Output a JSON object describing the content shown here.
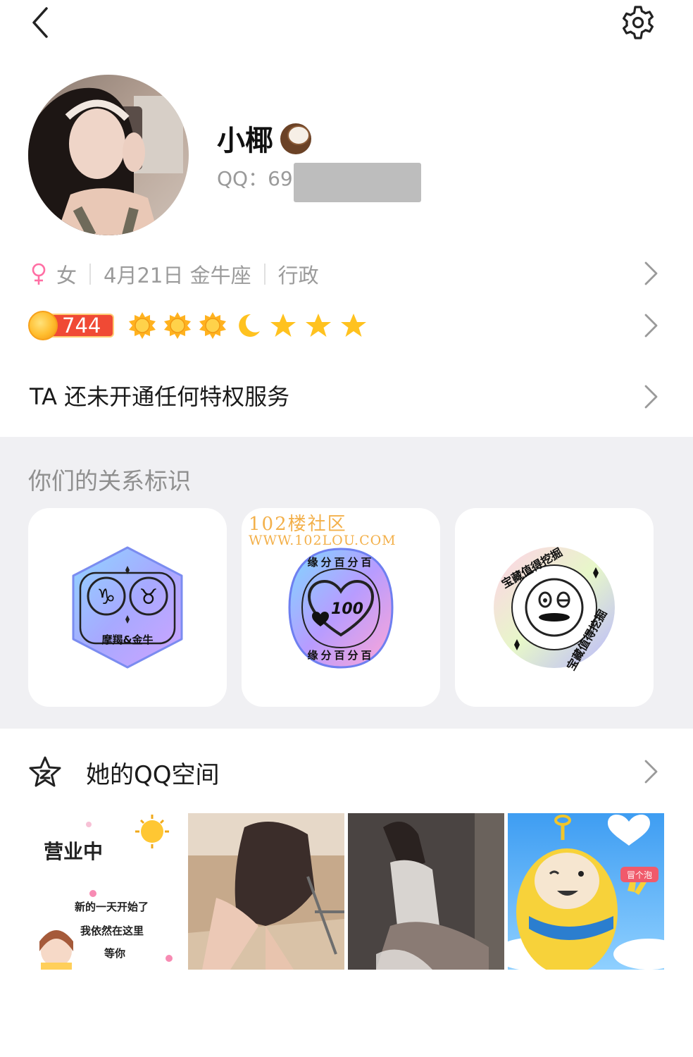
{
  "header": {
    "back_icon": "chevron-left-icon",
    "settings_icon": "gear-icon"
  },
  "profile": {
    "name": "小椰",
    "name_emoji": "coconut-emoji",
    "qq_label": "QQ：69",
    "gender": "女",
    "birthday": "4月21日 金牛座",
    "job": "行政",
    "level": "744",
    "level_icons": [
      "sun",
      "sun",
      "sun",
      "moon",
      "star",
      "star",
      "star"
    ]
  },
  "privilege": {
    "text": "TA 还未开通任何特权服务"
  },
  "relation": {
    "title": "你们的关系标识",
    "badges": [
      {
        "label": "摩羯&金牛"
      },
      {
        "top": "缘分百分百",
        "bottom": "缘分百分百",
        "center": "100"
      },
      {
        "top": "宝藏值得挖掘",
        "bottom": "宝藏值得挖掘"
      }
    ],
    "watermark_title": "102楼社区",
    "watermark_url": "WWW.102LOU.COM"
  },
  "qzone": {
    "title": "她的QQ空间",
    "photos": [
      {
        "lines": [
          "营业中",
          "新的一天开始了",
          "我依然在这里",
          "等你"
        ]
      },
      {
        "lines": []
      },
      {
        "lines": []
      },
      {
        "tag": "冒个泡"
      }
    ]
  },
  "colors": {
    "accent_red": "#f04a35",
    "section_bg": "#f0f0f3",
    "muted_text": "#9b9b9b",
    "female_pink": "#ff6fa4"
  }
}
